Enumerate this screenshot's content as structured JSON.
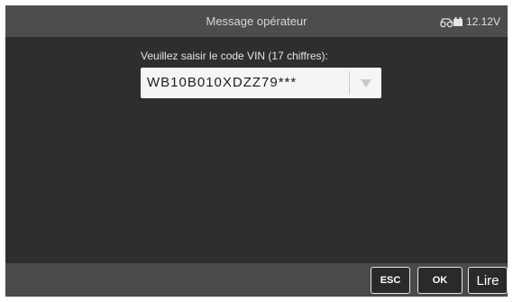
{
  "window": {
    "title": "Message opérateur"
  },
  "status": {
    "voltage": "12.12V",
    "icon": "car-battery-icon"
  },
  "main": {
    "prompt": "Veuillez saisir le code VIN (17 chiffres):",
    "vin_value": "WB10B010XDZZ79***"
  },
  "footer": {
    "esc_label": "ESC",
    "ok_label": "OK",
    "lire_label": "Lire"
  },
  "colors": {
    "titlebar": "#4d4d4d",
    "background": "#2e2e2e",
    "footer": "#4a4a4a",
    "button_border": "#e6e6e6"
  }
}
